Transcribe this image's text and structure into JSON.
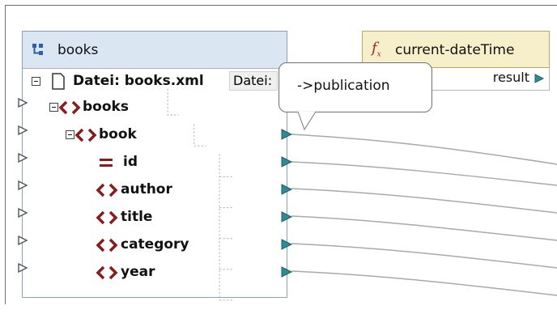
{
  "source_panel": {
    "title": "books",
    "file_label": "Datei: books.xml",
    "file_button": "Datei:",
    "nodes": [
      {
        "label": "books"
      },
      {
        "label": "book"
      },
      {
        "label": "id"
      },
      {
        "label": "author"
      },
      {
        "label": "title"
      },
      {
        "label": "category"
      },
      {
        "label": "year"
      }
    ]
  },
  "function_box": {
    "title": "current-dateTime",
    "output_label": "result"
  },
  "tooltip": {
    "text": "->publication"
  },
  "colors": {
    "panel_header": "#dbe6f3",
    "function_header": "#f7efc9",
    "connector": "#2e8b95",
    "element_icon": "#8b1a1a"
  },
  "icons": {
    "panel": "tree-icon",
    "function": "function-icon",
    "element": "element-icon",
    "attribute": "attribute-icon"
  }
}
